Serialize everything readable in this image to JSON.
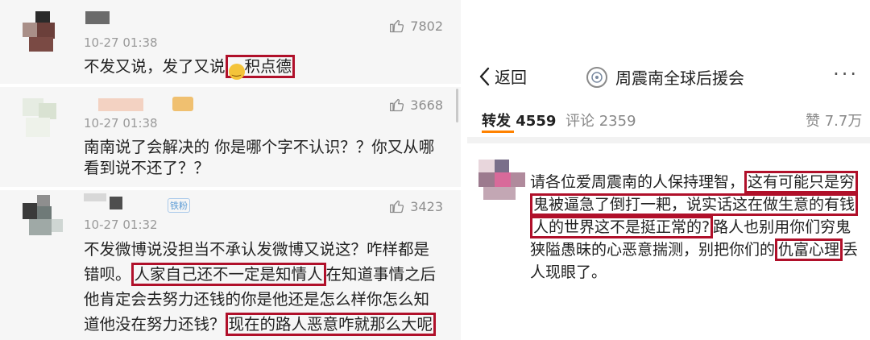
{
  "left": {
    "comments": [
      {
        "time": "10-27 01:38",
        "likes": "7802",
        "text_plain": "不发又说，发了又说",
        "text_boxed": "积点德"
      },
      {
        "time": "10-27 01:38",
        "likes": "3668",
        "text_line1": "南南说了会解决的 你是哪个字不认识？？你又从哪",
        "text_line2": "看到说不还了？？"
      },
      {
        "time": "10-27 01:32",
        "likes": "3423",
        "badge": "铁粉",
        "l1": "不发微博说没担当不承认发微博又说这？咋样都是",
        "l2a": "错呗。",
        "l2box": "人家自己还不一定是知情人",
        "l2b": "在知道事情之后",
        "l3": "他肯定会去努力还钱的你是他还是怎么样你怎么知",
        "l4a": "道他没在努力还钱？",
        "l4box": "现在的路人恶意咋就那么大呢"
      }
    ]
  },
  "right": {
    "back_label": "返回",
    "title": "周震南全球后援会",
    "more_label": "···",
    "tabs": {
      "repost_label": "转发",
      "repost_count": "4559",
      "comment_label": "评论",
      "comment_count": "2359",
      "like_label": "赞",
      "like_count": "7.7万"
    },
    "post": {
      "p1": "请各位爱周震南的人保持理智，",
      "box1a": "这有可能只是穷",
      "box1b": "鬼被逼急了倒打一耙，说实话这在做生意的有钱",
      "box1c": "人的世界这不是挺正常的?",
      "p2": "路人也别用你们穷鬼",
      "p3": "狭隘愚昧的心恶意揣测，别把你们的",
      "box2": "仇富心理",
      "p4": "丢",
      "p5": "人现眼了。"
    }
  },
  "colors": {
    "highlight_box": "#b0102a",
    "background_panel": "#f6f6f6"
  }
}
